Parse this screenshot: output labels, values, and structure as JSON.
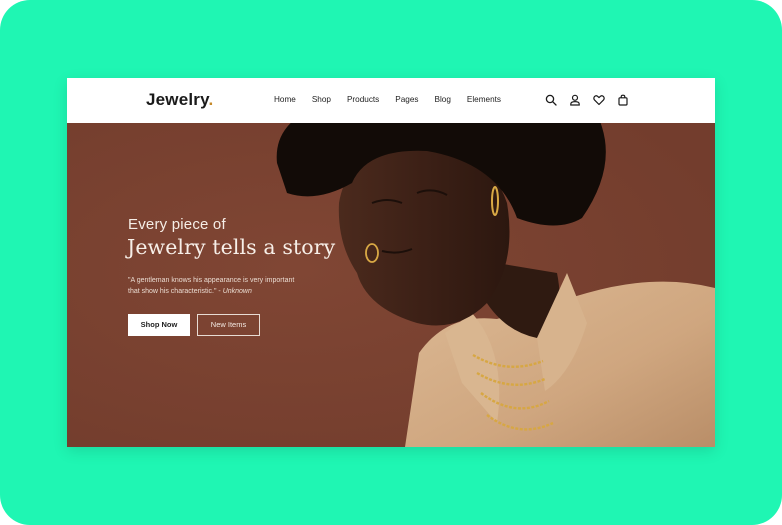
{
  "header": {
    "logo_text": "Jewelry",
    "logo_dot": ".",
    "nav": [
      {
        "label": "Home"
      },
      {
        "label": "Shop"
      },
      {
        "label": "Products"
      },
      {
        "label": "Pages"
      },
      {
        "label": "Blog"
      },
      {
        "label": "Elements"
      }
    ],
    "icons": [
      "search-icon",
      "user-icon",
      "heart-icon",
      "bag-icon"
    ]
  },
  "hero": {
    "kicker": "Every piece of",
    "headline": "Jewelry tells a story",
    "quote_line1": "\"A gentleman knows his appearance is very important",
    "quote_line2": "that show his characteristic.\" - ",
    "quote_author": "Unknown",
    "primary_button": "Shop Now",
    "secondary_button": "New Items"
  },
  "colors": {
    "background": "#1ff6b3",
    "hero_brown": "#7a4130",
    "accent_gold": "#c58a2b",
    "jacket_tan": "#d5b08c"
  }
}
